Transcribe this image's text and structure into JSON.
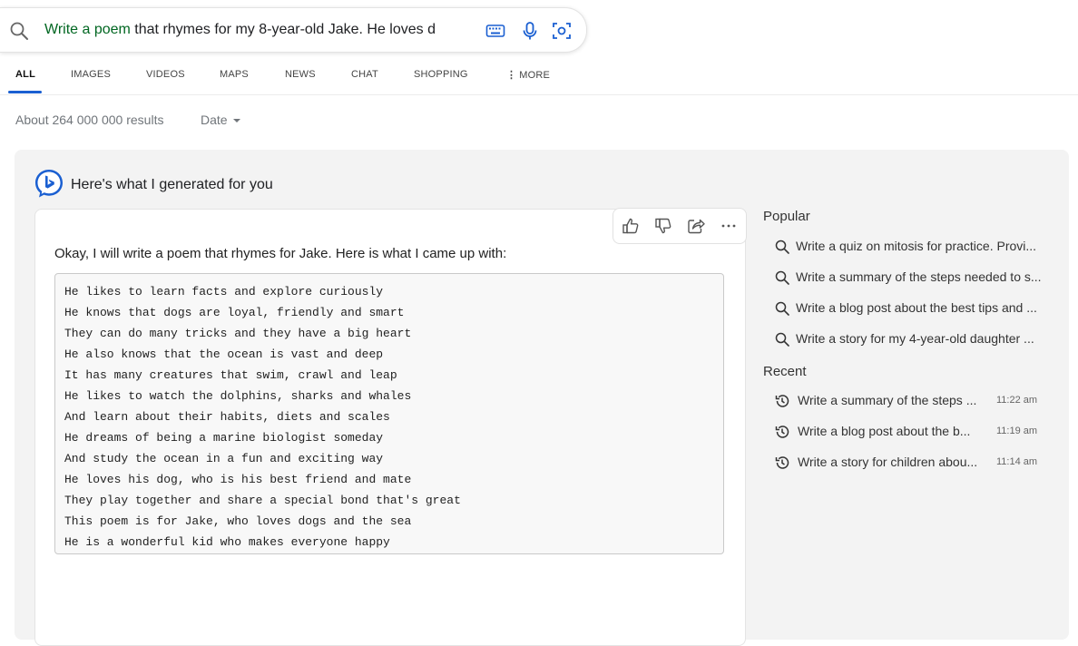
{
  "search": {
    "query_highlight": "Write a poem",
    "query_rest": " that rhymes for my 8-year-old Jake. He loves d",
    "icons": [
      "search-icon",
      "keyboard-icon",
      "microphone-icon",
      "visual-search-icon"
    ]
  },
  "tabs": [
    {
      "label": "ALL",
      "active": true
    },
    {
      "label": "IMAGES"
    },
    {
      "label": "VIDEOS"
    },
    {
      "label": "MAPS"
    },
    {
      "label": "NEWS"
    },
    {
      "label": "CHAT"
    },
    {
      "label": "SHOPPING"
    },
    {
      "label": "MORE"
    }
  ],
  "results": {
    "count": "About 264 000 000 results",
    "date_filter": "Date"
  },
  "panel": {
    "title": "Here's what I generated for you",
    "intro": "Okay, I will write a poem that rhymes for Jake. Here is what I came up with:",
    "actions": [
      "thumbs-up-icon",
      "thumbs-down-icon",
      "share-icon",
      "more-options-icon"
    ],
    "poem": [
      "He likes to learn facts and explore curiously",
      "He knows that dogs are loyal, friendly and smart",
      "They can do many tricks and they have a big heart",
      "He also knows that the ocean is vast and deep",
      "It has many creatures that swim, crawl and leap",
      "He likes to watch the dolphins, sharks and whales",
      "And learn about their habits, diets and scales",
      "He dreams of being a marine biologist someday",
      "And study the ocean in a fun and exciting way",
      "He loves his dog, who is his best friend and mate",
      "They play together and share a special bond that's great",
      "This poem is for Jake, who loves dogs and the sea",
      "He is a wonderful kid who makes everyone happy"
    ]
  },
  "sidebar": {
    "popular_heading": "Popular",
    "popular": [
      "Write a quiz on mitosis for practice. Provi...",
      "Write a summary of the steps needed to s...",
      "Write a blog post about the best tips and ...",
      "Write a story for my 4-year-old daughter ..."
    ],
    "recent_heading": "Recent",
    "recent": [
      {
        "text": "Write a summary of the steps ...",
        "time": "11:22 am"
      },
      {
        "text": "Write a blog post about the b...",
        "time": "11:19 am"
      },
      {
        "text": "Write a story for children abou...",
        "time": "11:14 am"
      }
    ]
  },
  "colors": {
    "accent": "#1a5fd1",
    "query_highlight": "#006621",
    "panel_bg": "#f3f3f3"
  }
}
